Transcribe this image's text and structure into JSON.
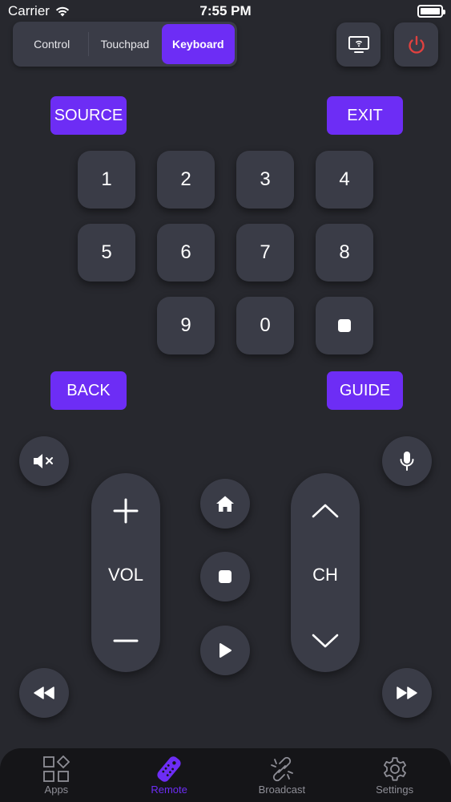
{
  "status_bar": {
    "carrier": "Carrier",
    "time": "7:55 PM"
  },
  "mode_tabs": [
    {
      "label": "Control",
      "active": false
    },
    {
      "label": "Touchpad",
      "active": false
    },
    {
      "label": "Keyboard",
      "active": true
    }
  ],
  "top_actions": {
    "cast_icon": "tv-cast-icon",
    "power_icon": "power-icon"
  },
  "buttons": {
    "source": "SOURCE",
    "exit": "EXIT",
    "back": "BACK",
    "guide": "GUIDE"
  },
  "numpad": [
    "1",
    "2",
    "3",
    "4",
    "5",
    "6",
    "7",
    "8",
    "9",
    "0"
  ],
  "controls": {
    "volume_label": "VOL",
    "channel_label": "CH"
  },
  "tabbar": [
    {
      "label": "Apps",
      "icon": "apps-grid-icon",
      "active": false
    },
    {
      "label": "Remote",
      "icon": "remote-icon",
      "active": true
    },
    {
      "label": "Broadcast",
      "icon": "broadcast-icon",
      "active": false
    },
    {
      "label": "Settings",
      "icon": "gear-icon",
      "active": false
    }
  ],
  "colors": {
    "background": "#27282e",
    "button": "#3a3c47",
    "accent": "#6d2df5",
    "power": "#e0413f",
    "tabbar": "#151518"
  }
}
